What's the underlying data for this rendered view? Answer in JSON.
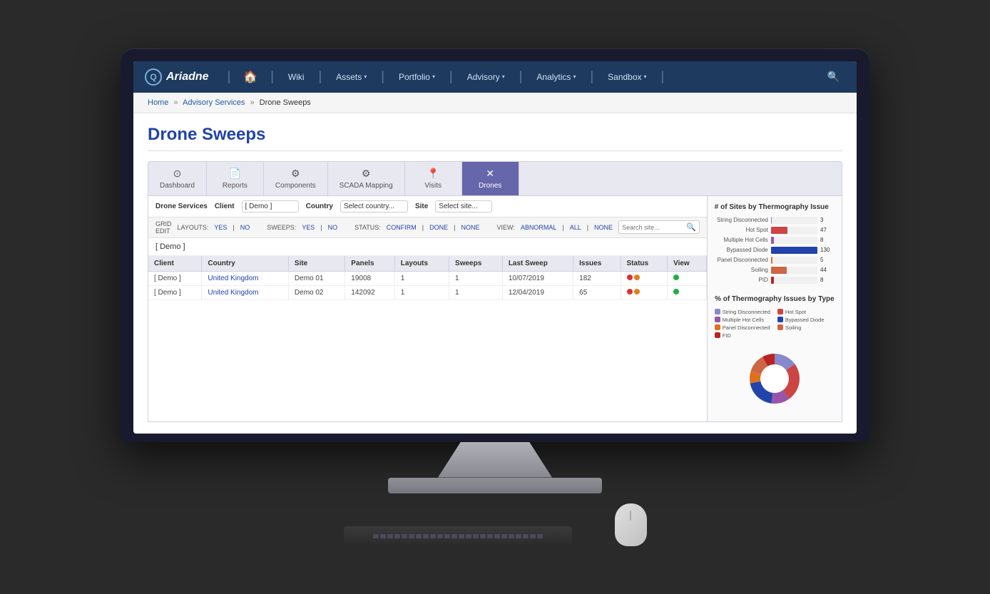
{
  "monitor": {
    "nav": {
      "logo_text": "Ariadne",
      "home_icon": "🏠",
      "search_icon": "🔍",
      "items": [
        {
          "label": "Wiki",
          "has_dropdown": false
        },
        {
          "label": "Assets",
          "has_dropdown": true
        },
        {
          "label": "Portfolio",
          "has_dropdown": true
        },
        {
          "label": "Advisory",
          "has_dropdown": true
        },
        {
          "label": "Analytics",
          "has_dropdown": true
        },
        {
          "label": "Sandbox",
          "has_dropdown": true
        }
      ]
    },
    "breadcrumb": {
      "items": [
        "Home",
        "Advisory Services",
        "Drone Sweeps"
      ],
      "links": [
        true,
        true,
        false
      ]
    },
    "page": {
      "title": "Drone Sweeps"
    },
    "tabs": [
      {
        "label": "Dashboard",
        "icon": "⊙",
        "active": false
      },
      {
        "label": "Reports",
        "icon": "📄",
        "active": false
      },
      {
        "label": "Components",
        "icon": "⚙",
        "active": false
      },
      {
        "label": "SCADA Mapping",
        "icon": "⚙",
        "active": false
      },
      {
        "label": "Visits",
        "icon": "📍",
        "active": false
      },
      {
        "label": "Drones",
        "icon": "✕",
        "active": true
      }
    ],
    "filters": {
      "client_label": "Client",
      "client_value": "[ Demo ]",
      "country_label": "Country",
      "country_placeholder": "Select country...",
      "site_label": "Site",
      "site_placeholder": "Select site..."
    },
    "sub_filters": {
      "grid_edit_label": "GRID EDIT",
      "layouts_label": "LAYOUTS:",
      "layouts_yes": "YES",
      "layouts_no": "NO",
      "sweeps_label": "SWEEPS:",
      "sweeps_yes": "YES",
      "sweeps_no": "NO",
      "status_label": "STATUS:",
      "status_confirm": "CONFIRM",
      "status_done": "DONE",
      "status_none": "NONE",
      "view_label": "VIEW:",
      "view_abnormal": "ABNORMAL",
      "view_all": "ALL",
      "view_none": "NONE",
      "search_placeholder": "Search site..."
    },
    "demo_label": "[ Demo ]",
    "table": {
      "headers": [
        "Client",
        "Country",
        "Site",
        "Panels",
        "Layouts",
        "Sweeps",
        "Last Sweep",
        "Issues",
        "Status",
        "View"
      ],
      "rows": [
        {
          "client": "[ Demo ]",
          "country": "United Kingdom",
          "site": "Demo 01",
          "panels": "19008",
          "layouts": "1",
          "sweeps": "1",
          "last_sweep": "10/07/2019",
          "issues": "182",
          "status_dot1": "red",
          "status_dot2": "orange",
          "view_dot": "green"
        },
        {
          "client": "[ Demo ]",
          "country": "United Kingdom",
          "site": "Demo 02",
          "panels": "142092",
          "layouts": "1",
          "sweeps": "1",
          "last_sweep": "12/04/2019",
          "issues": "65",
          "status_dot1": "red",
          "status_dot2": "orange",
          "view_dot": "green"
        }
      ]
    },
    "charts": {
      "bar_chart_title": "# of Sites by Thermography Issue",
      "bar_items": [
        {
          "label": "String Disconnected",
          "value": 3,
          "max": 40,
          "color": "#8888cc"
        },
        {
          "label": "Hot Spot",
          "value": 47,
          "max": 130,
          "color": "#cc4444"
        },
        {
          "label": "Multiple Hot Cells",
          "value": 8,
          "max": 40,
          "color": "#9955aa"
        },
        {
          "label": "Bypassed Diode",
          "value": 130,
          "max": 130,
          "color": "#2244aa"
        },
        {
          "label": "Panel Disconnected",
          "value": 5,
          "max": 40,
          "color": "#e07020"
        },
        {
          "label": "Soiling",
          "value": 44,
          "max": 130,
          "color": "#cc6644"
        },
        {
          "label": "PID",
          "value": 8,
          "max": 40,
          "color": "#bb2222"
        }
      ],
      "donut_title": "% of Thermography Issues by Type",
      "donut_legend": [
        {
          "label": "String Disconnected",
          "color": "#8888cc"
        },
        {
          "label": "Hot Spot",
          "color": "#cc4444"
        },
        {
          "label": "Multiple Hot Cells",
          "color": "#9955aa"
        },
        {
          "label": "Bypassed Diode",
          "color": "#2244aa"
        },
        {
          "label": "Panel Disconnected",
          "color": "#e07020"
        },
        {
          "label": "Soiling",
          "color": "#cc6644"
        },
        {
          "label": "FID",
          "color": "#bb2222"
        }
      ],
      "donut_segments": [
        {
          "pct": 15,
          "color": "#8888cc"
        },
        {
          "pct": 25,
          "color": "#cc4444"
        },
        {
          "pct": 12,
          "color": "#9955aa"
        },
        {
          "pct": 20,
          "color": "#2244aa"
        },
        {
          "pct": 8,
          "color": "#e07020"
        },
        {
          "pct": 12,
          "color": "#cc6644"
        },
        {
          "pct": 8,
          "color": "#bb2222"
        }
      ]
    }
  }
}
